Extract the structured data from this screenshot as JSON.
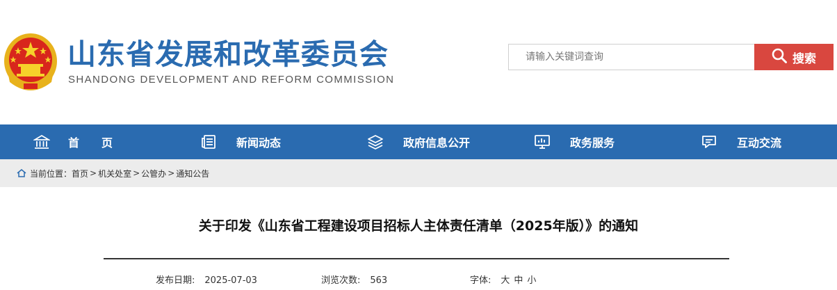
{
  "header": {
    "title_cn": "山东省发展和改革委员会",
    "title_en": "SHANDONG DEVELOPMENT AND REFORM COMMISSION",
    "emblem_icon": "national-emblem-icon"
  },
  "search": {
    "placeholder": "请输入关键词查询",
    "button_label": "搜索",
    "button_color": "#d9473f"
  },
  "nav": {
    "color": "#2a6bb0",
    "items": [
      {
        "label": "首　　页",
        "icon": "home-building-icon"
      },
      {
        "label": "新闻动态",
        "icon": "news-icon"
      },
      {
        "label": "政府信息公开",
        "icon": "layers-icon"
      },
      {
        "label": "政务服务",
        "icon": "monitor-icon"
      },
      {
        "label": "互动交流",
        "icon": "chat-icon"
      }
    ]
  },
  "breadcrumb": {
    "prefix": "当前位置：",
    "items": [
      "首页",
      "机关处室",
      "公管办",
      "通知公告"
    ],
    "separator": ">"
  },
  "article": {
    "title": "关于印发《山东省工程建设项目招标人主体责任清单（2025年版）》的通知",
    "publish_label": "发布日期:",
    "publish_date": "2025-07-03",
    "views_label": "浏览次数:",
    "views": "563",
    "font_label": "字体:",
    "font_large": "大",
    "font_medium": "中",
    "font_small": "小"
  }
}
